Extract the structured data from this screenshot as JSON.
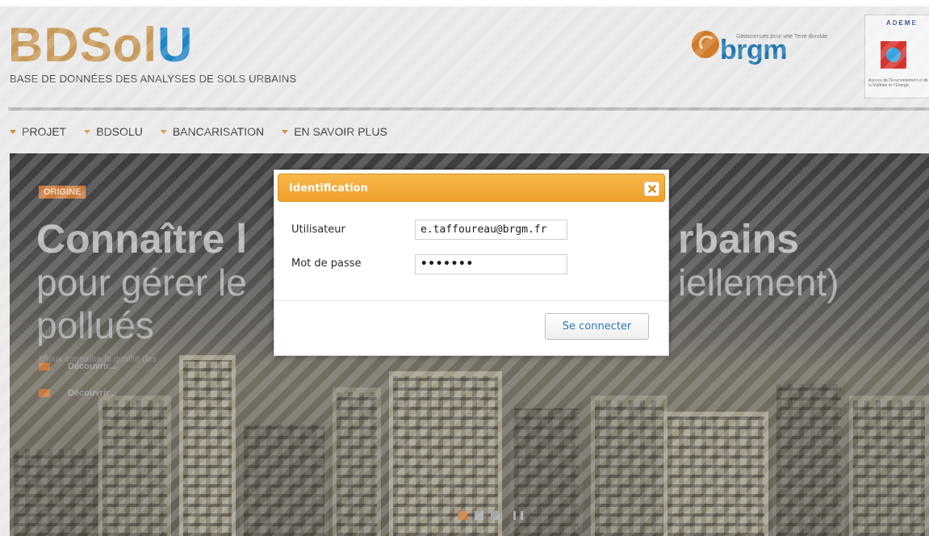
{
  "header": {
    "logo_part1": "BDSol",
    "logo_part2": "U",
    "subtitle": "BASE DE DONNÉES DES ANALYSES DE SOLS URBAINS",
    "brgm_name": "brgm",
    "brgm_tagline": "Géosciences pour une Terre durable",
    "ademe_title": "ADEME",
    "ademe_text": "Agence de l'Environnement et de la Maîtrise de l'Énergie"
  },
  "nav": {
    "items": [
      {
        "label": "PROJET"
      },
      {
        "label": "BDSOLU"
      },
      {
        "label": "BANCARISATION"
      },
      {
        "label": "EN SAVOIR PLUS"
      }
    ]
  },
  "hero": {
    "tag": "ORIGINE",
    "title_left": "Connaître l",
    "title_right": "rbains",
    "line2_left": "pour gérer le",
    "line2_right": "iellement)",
    "line3": "pollués",
    "small_text": "Mieux connaître la qualité des",
    "link1": "Découvrir...",
    "link2": "Découvrir..."
  },
  "carousel": {
    "slides": 3,
    "active_index": 0
  },
  "modal": {
    "title": "Identification",
    "user_label": "Utilisateur",
    "user_value": "e.taffoureau@brgm.fr",
    "password_label": "Mot de passe",
    "password_value": "•••••••",
    "submit_label": "Se connecter"
  },
  "colors": {
    "accent_orange": "#f0a02c",
    "logo_tan": "#c89a5a",
    "logo_blue": "#1f86c6",
    "button_text": "#2b7ab5"
  }
}
